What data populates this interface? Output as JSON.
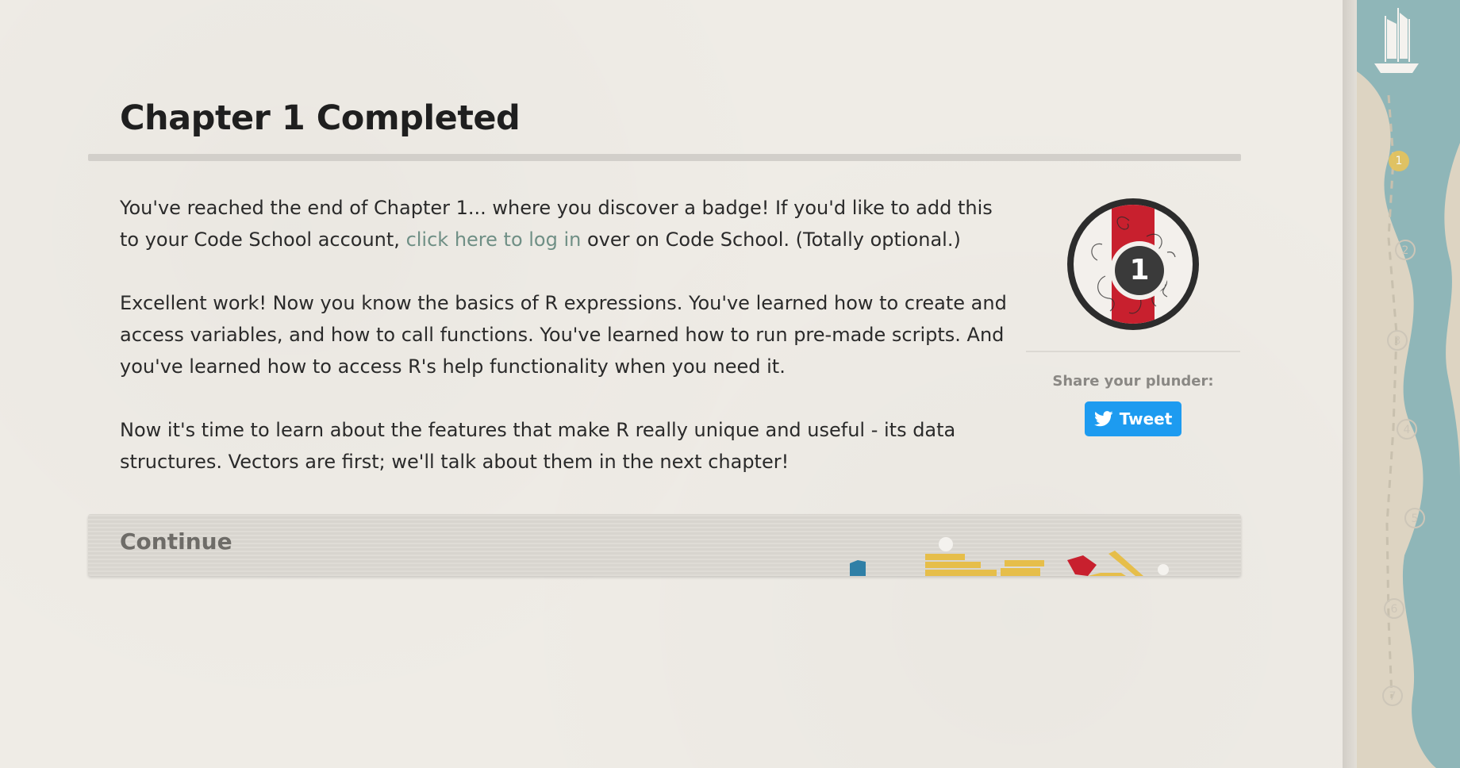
{
  "chapter": {
    "title": "Chapter 1 Completed"
  },
  "body": {
    "paragraph1_before_link": "You've reached the end of Chapter 1... where you discover a badge! If you'd like to add this to your Code School account, ",
    "login_link_label": "click here to log in",
    "paragraph1_after_link": " over on Code School. (Totally optional.)",
    "paragraph2": "Excellent work! Now you know the basics of R expressions. You've learned how to create and access variables, and how to call functions. You've learned how to run pre-made scripts. And you've learned how to access R's help functionality when you need it.",
    "paragraph3": "Now it's time to learn about the features that make R really unique and useful - its data structures. Vectors are first; we'll talk about them in the next chapter!"
  },
  "badge": {
    "number": "1",
    "icon": "chapter-badge-icon",
    "stripe_color": "#c8202e"
  },
  "share": {
    "label": "Share your plunder:",
    "tweet_label": "Tweet",
    "tweet_color": "#1d9bf0"
  },
  "continue": {
    "label": "Continue"
  },
  "map": {
    "icon": "ship-icon",
    "chapters": [
      "1",
      "2",
      "3",
      "4",
      "5",
      "6",
      "7"
    ],
    "current_chapter": "1"
  },
  "colors": {
    "background": "#efece6",
    "link": "#6f8f85",
    "sea": "#8fb6b8",
    "current_marker": "#e8c45a"
  }
}
